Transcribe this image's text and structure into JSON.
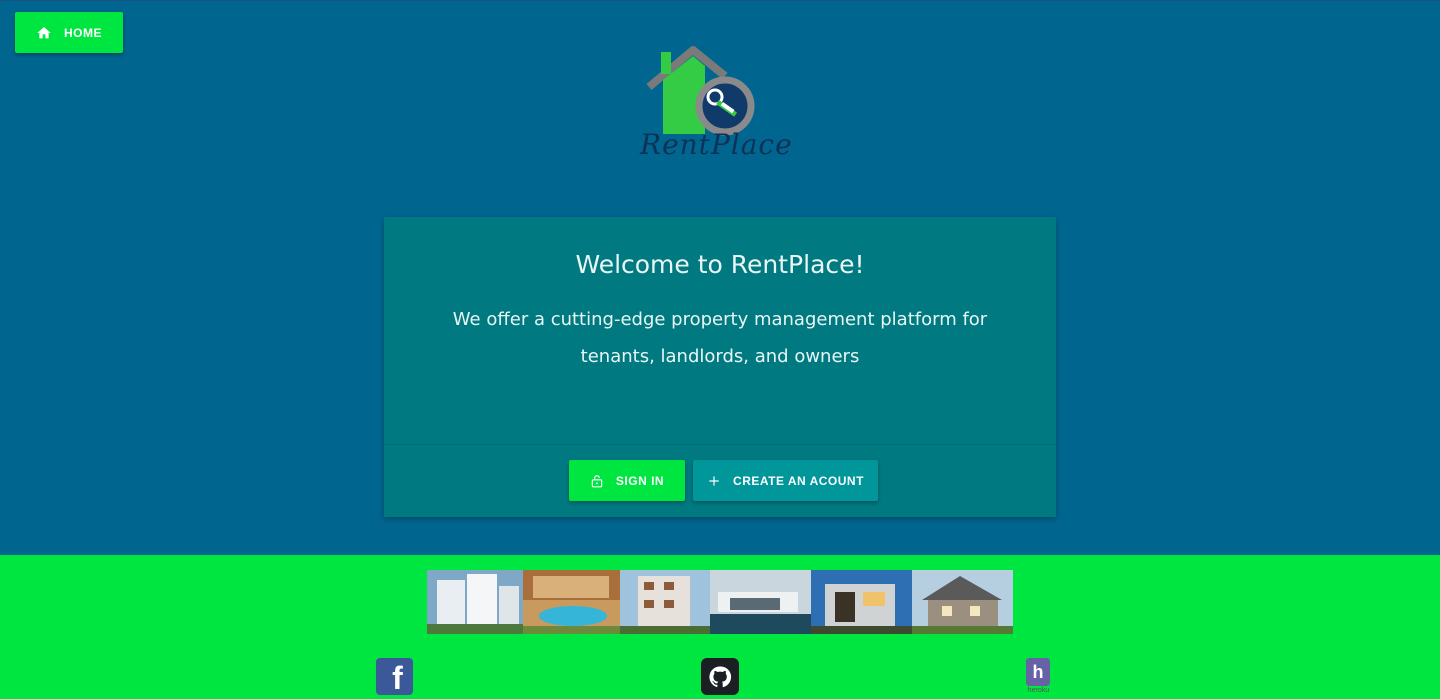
{
  "nav": {
    "home_label": "HOME",
    "home_icon": "home-icon"
  },
  "brand": {
    "logo_text": "RentPlace"
  },
  "hero": {
    "title": "Welcome to RentPlace!",
    "description": "We offer a cutting-edge property management platform for tenants, landlords, and owners",
    "signin_label": "SIGN IN",
    "signin_icon": "unlock-icon",
    "create_label": "CREATE AN ACOUNT",
    "create_icon": "plus-icon"
  },
  "footer": {
    "gallery": [
      "building-photo",
      "pool-apartment-photo",
      "apartment-block-photo",
      "modern-villa-photo",
      "modern-house-photo",
      "suburban-house-photo"
    ],
    "social": [
      {
        "name": "facebook",
        "icon": "facebook-icon"
      },
      {
        "name": "github",
        "icon": "github-icon"
      },
      {
        "name": "heroku",
        "icon": "heroku-icon",
        "caption": "heroku"
      }
    ]
  },
  "colors": {
    "background": "#006690",
    "accent_green": "#00e641",
    "card": "#007a80",
    "teal_button": "#00969a"
  }
}
